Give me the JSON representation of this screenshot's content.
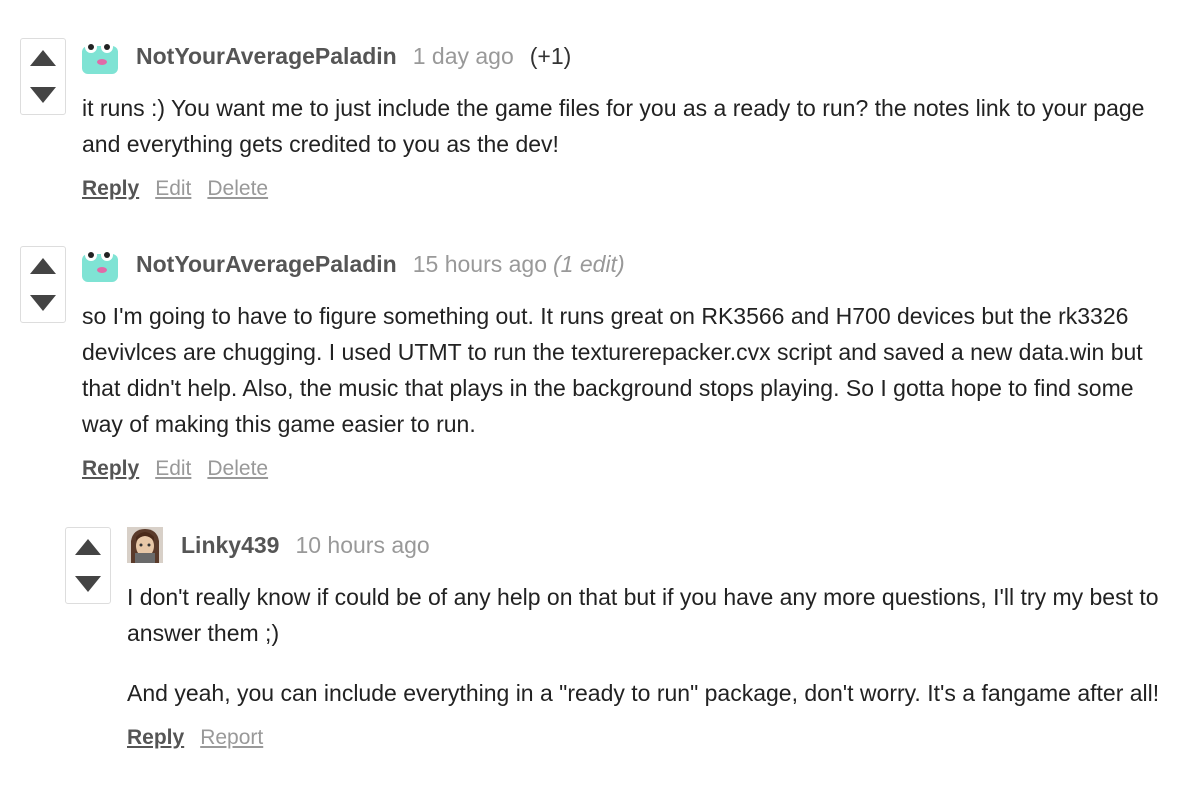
{
  "comments": [
    {
      "author": "NotYourAveragePaladin",
      "time": "1 day ago",
      "votes": "(+1)",
      "paragraphs": [
        "it runs :) You want me to just include the game files for you as a ready to run? the notes link to your page and everything gets credited to you as the dev!"
      ],
      "actions": [
        "Reply",
        "Edit",
        "Delete"
      ]
    },
    {
      "author": "NotYourAveragePaladin",
      "time": "15 hours ago",
      "edited": "(1 edit)",
      "paragraphs": [
        "so I'm going to have to figure something out. It runs great on RK3566 and H700 devices but the rk3326 devivlces are chugging. I used UTMT to run the texturerepacker.cvx script and saved a new data.win but that didn't help. Also, the music that plays in the background stops playing. So I gotta hope to find some way of making this game easier to run."
      ],
      "actions": [
        "Reply",
        "Edit",
        "Delete"
      ]
    },
    {
      "author": "Linky439",
      "time": "10 hours ago",
      "paragraphs": [
        "I don't really know if could be of any help on that but if you have any more questions, I'll try my best to answer them ;)",
        "And yeah, you can include everything in a \"ready to run\" package, don't worry. It's a fangame after all!"
      ],
      "actions": [
        "Reply",
        "Report"
      ]
    }
  ],
  "icons": {
    "upvote": "arrow-up-icon",
    "downvote": "arrow-down-icon"
  },
  "colors": {
    "author": "#555555",
    "muted": "#999999",
    "text": "#222222",
    "vote_border": "#dddddd",
    "avatar_frog": "#7fe3d4"
  }
}
